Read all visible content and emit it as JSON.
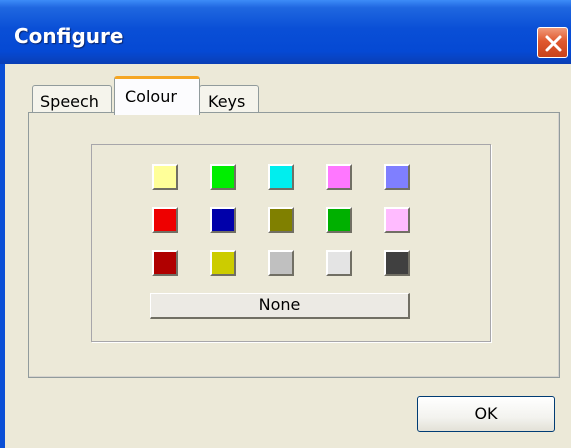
{
  "window": {
    "title": "Configure"
  },
  "tabs": [
    {
      "label": "Speech",
      "selected": false
    },
    {
      "label": "Colour",
      "selected": true
    },
    {
      "label": "Keys",
      "selected": false
    }
  ],
  "colour_grid": {
    "rows": [
      [
        "#ffff99",
        "#00ee00",
        "#00eeee",
        "#ff77ff",
        "#7f7fff"
      ],
      [
        "#ee0000",
        "#0000aa",
        "#808000",
        "#00b000",
        "#ffbbff"
      ],
      [
        "#b00000",
        "#cccc00",
        "#c0c0c0",
        "#e4e4e4",
        "#404040"
      ]
    ],
    "none_label": "None"
  },
  "buttons": {
    "ok_label": "OK"
  },
  "icons": {
    "close": "close-icon"
  }
}
